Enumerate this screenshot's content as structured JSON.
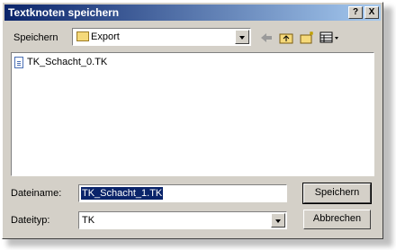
{
  "window": {
    "title": "Textknoten speichern",
    "help_label": "?",
    "close_label": "X"
  },
  "location": {
    "label": "Speichern",
    "folder": "Export"
  },
  "toolbar": {
    "icons": [
      "back-arrow-icon",
      "up-folder-icon",
      "new-folder-icon",
      "view-menu-icon"
    ]
  },
  "files": [
    {
      "name": "TK_Schacht_0.TK"
    }
  ],
  "filename": {
    "label": "Dateiname:",
    "value": "TK_Schacht_1.TK"
  },
  "filetype": {
    "label": "Dateityp:",
    "value": "TK"
  },
  "buttons": {
    "save": "Speichern",
    "cancel": "Abbrechen"
  }
}
